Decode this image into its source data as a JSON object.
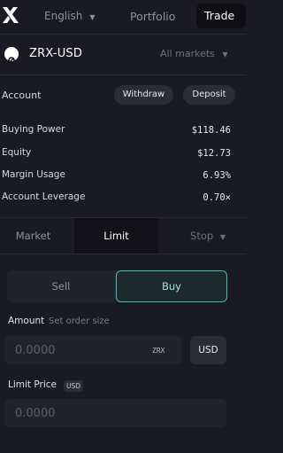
{
  "header": {
    "language": "English",
    "tabs": [
      "Portfolio",
      "Trade"
    ],
    "active_tab": "Trade"
  },
  "market": {
    "pair": "ZRX-USD",
    "all_markets": "All markets"
  },
  "account": {
    "label": "Account",
    "withdraw": "Withdraw",
    "deposit": "Deposit",
    "stats": [
      {
        "label": "Buying Power",
        "value": "$118.46"
      },
      {
        "label": "Equity",
        "value": "$12.73"
      },
      {
        "label": "Margin Usage",
        "value": "6.93%"
      },
      {
        "label": "Account Leverage",
        "value": "0.70×"
      }
    ]
  },
  "order": {
    "tabs": {
      "market": "Market",
      "limit": "Limit",
      "stop": "Stop"
    },
    "active_tab": "Limit",
    "sell": "Sell",
    "buy": "Buy",
    "active_side": "Buy",
    "amount_label": "Amount",
    "amount_hint": "Set order size",
    "amount_placeholder": "0.0000",
    "amount_unit": "ZRX",
    "amount_toggle": "USD",
    "limit_label": "Limit Price",
    "limit_unit": "USD",
    "limit_placeholder": "0.0000"
  },
  "colors": {
    "background": "#1a1a22",
    "accent": "#3fbfb0",
    "muted": "#8f8fa0"
  }
}
